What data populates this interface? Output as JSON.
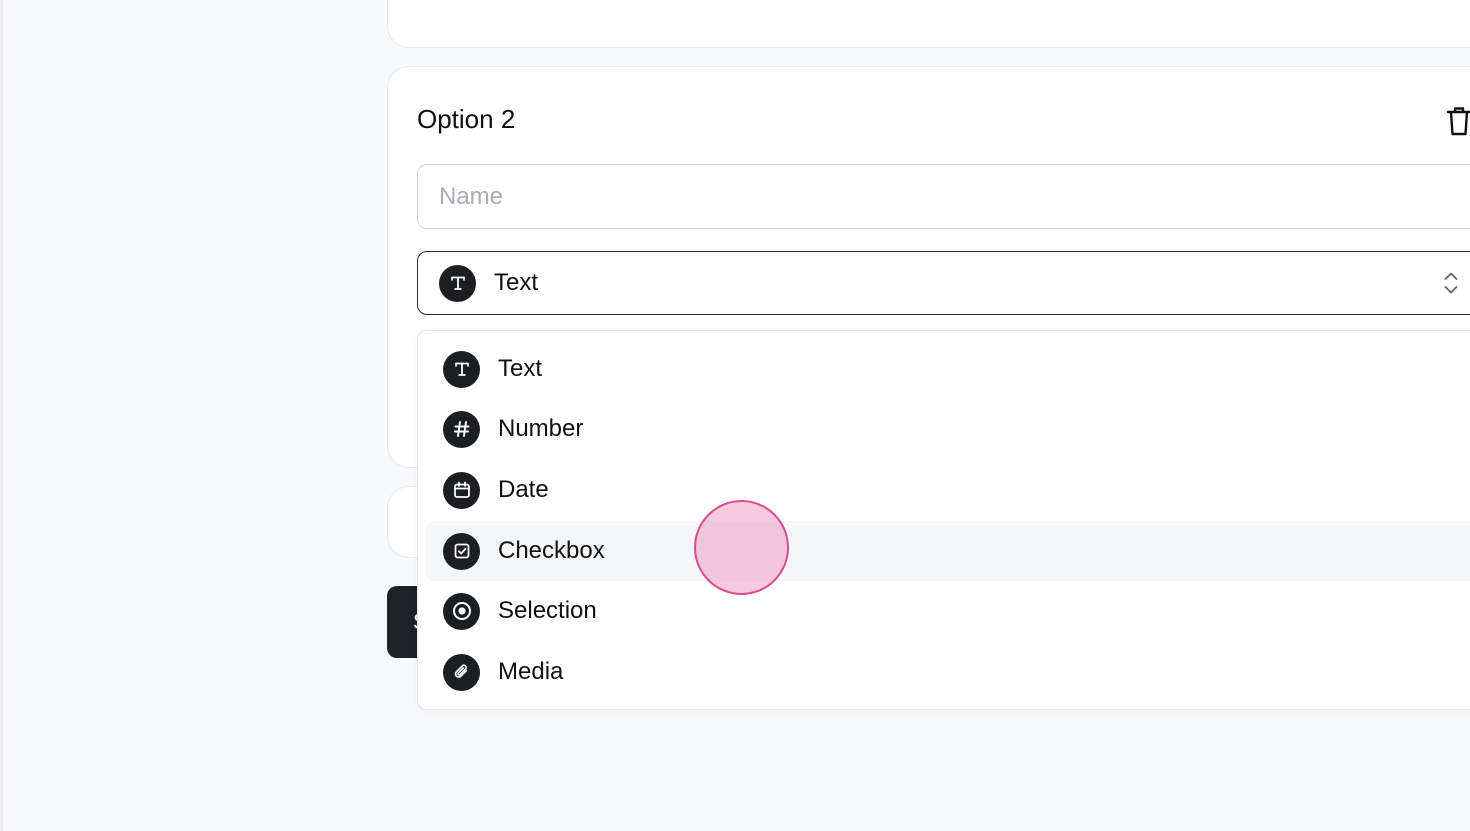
{
  "option_card": {
    "title": "Option 2",
    "name_input": {
      "placeholder": "Name",
      "value": ""
    },
    "type_select": {
      "selected_label": "Text",
      "selected_icon": "text-icon"
    }
  },
  "bottom_button": {
    "label": "S"
  },
  "dropdown": {
    "items": [
      {
        "label": "Text",
        "icon": "text-icon"
      },
      {
        "label": "Number",
        "icon": "hash-icon"
      },
      {
        "label": "Date",
        "icon": "calendar-icon"
      },
      {
        "label": "Checkbox",
        "icon": "checkbox-icon"
      },
      {
        "label": "Selection",
        "icon": "radio-icon"
      },
      {
        "label": "Media",
        "icon": "paperclip-icon"
      }
    ],
    "highlighted_item": "Checkbox"
  },
  "colors": {
    "page_bg": "#f8f9fa",
    "icon_bg": "#1c1e21",
    "highlight_bg": "#f5f6f8",
    "cursor_ring": "#d94b95"
  }
}
